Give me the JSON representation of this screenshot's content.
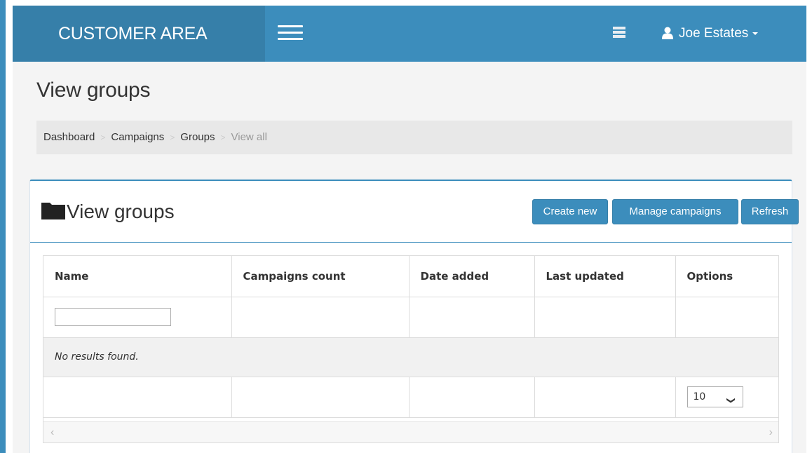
{
  "header": {
    "brand": "CUSTOMER AREA",
    "user_name": "Joe Estates"
  },
  "page": {
    "title": "View groups"
  },
  "breadcrumb": [
    "Dashboard",
    "Campaigns",
    "Groups",
    "View all"
  ],
  "box": {
    "title": "View groups",
    "buttons": {
      "create": "Create new",
      "manage": "Manage campaigns",
      "refresh": "Refresh"
    }
  },
  "table": {
    "columns": [
      "Name",
      "Campaigns count",
      "Date added",
      "Last updated",
      "Options"
    ],
    "filter_value": "",
    "empty_message": "No results found.",
    "page_size": "10"
  },
  "colors": {
    "primary": "#3c8dbc",
    "brand_bg": "#367fa9",
    "content_bg": "#f4f4f4"
  },
  "icons": [
    "hamburger-icon",
    "notification-icon",
    "user-icon",
    "folder-icon",
    "chevron-down-icon"
  ]
}
